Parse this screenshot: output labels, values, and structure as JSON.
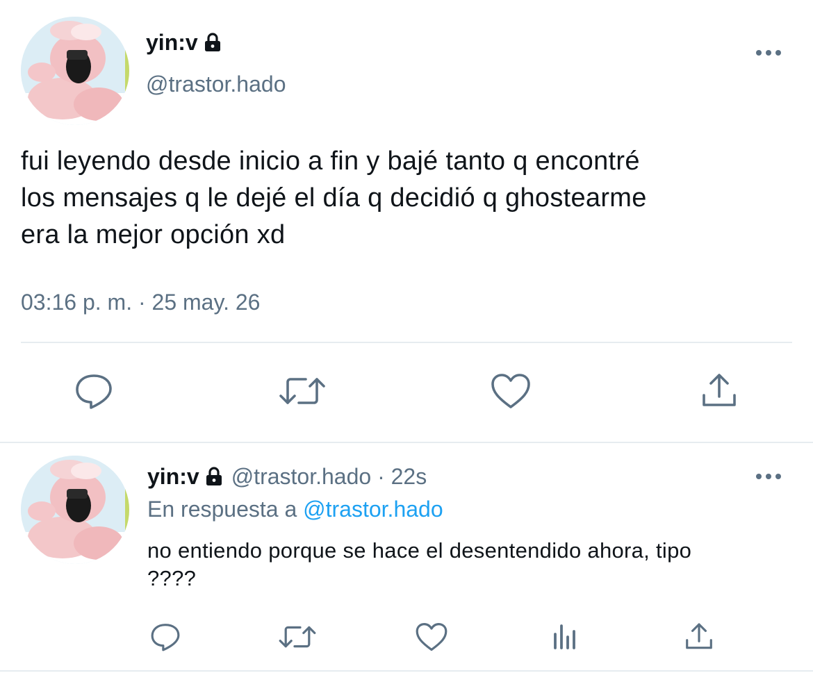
{
  "main_tweet": {
    "author_name": "yin:v",
    "author_handle": "@trastor.hado",
    "text": "fui leyendo desde inicio a fin y bajé tanto q encontré\nlos mensajes q le dejé el día q decidió q ghostearme\nera la mejor opción xd",
    "timestamp": "03:16 p. m. · 25 may. 26",
    "actions": [
      "reply-icon",
      "retweet-icon",
      "like-icon",
      "share-icon"
    ]
  },
  "reply_tweet": {
    "author_name": "yin:v",
    "author_handle": "@trastor.hado",
    "separator": "·",
    "age": "22s",
    "reply_prefix": "En respuesta a",
    "reply_mention": "@trastor.hado",
    "text": "no entiendo porque se hace el desentendido ahora, tipo\n????",
    "actions": [
      "reply-icon",
      "retweet-icon",
      "like-icon",
      "analytics-icon",
      "share-icon"
    ]
  },
  "colors": {
    "text": "#0f1419",
    "secondary": "#5b7083",
    "link": "#1da1f2",
    "divider": "#e6ecf0"
  }
}
